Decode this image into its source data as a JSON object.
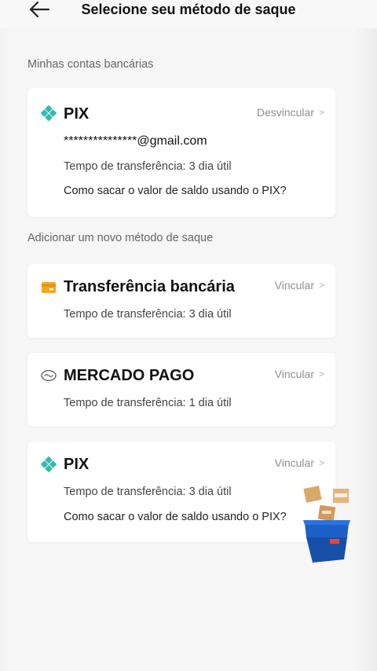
{
  "header": {
    "title": "Selecione seu método de saque",
    "back_icon": "arrow-left-icon"
  },
  "accounts_section": {
    "label": "Minhas contas bancárias",
    "linked": {
      "name": "PIX",
      "action": "Desvincular",
      "email": "***************@gmail.com",
      "transfer_time": "Tempo de transferência: 3 dia útil",
      "help_link": "Como sacar o valor de saldo usando o PIX?"
    }
  },
  "add_section": {
    "label": "Adicionar um novo método de saque",
    "methods": [
      {
        "name": "Transferência bancária",
        "action": "Vincular",
        "transfer_time": "Tempo de transferência: 3 dia útil",
        "icon": "bank-card-icon"
      },
      {
        "name": "MERCADO PAGO",
        "action": "Vincular",
        "transfer_time": "Tempo de transferência: 1 dia útil",
        "icon": "mercado-pago-icon"
      },
      {
        "name": "PIX",
        "action": "Vincular",
        "transfer_time": "Tempo de transferência: 3 dia útil",
        "help_link": "Como sacar o valor de saldo usando o PIX?",
        "icon": "pix-icon"
      }
    ]
  },
  "colors": {
    "pix": "#32bcad",
    "bank": "#f5a623",
    "accent_text": "#8f8f8f"
  }
}
